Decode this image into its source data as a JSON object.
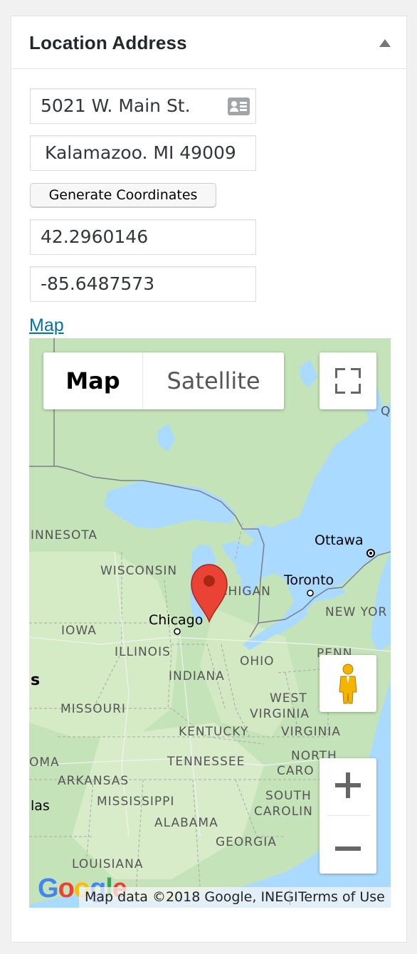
{
  "panel": {
    "title": "Location Address"
  },
  "fields": {
    "street_value": "5021 W. Main St.",
    "city_value": "Kalamazoo. MI 49009",
    "latitude_value": "42.2960146",
    "longitude_value": "-85.6487573"
  },
  "buttons": {
    "generate_label": "Generate Coordinates"
  },
  "map_link": {
    "label": "Map"
  },
  "map": {
    "type_map_label": "Map",
    "type_satellite_label": "Satellite",
    "attribution": "Map data ©2018 Google, INEGI",
    "terms_label": "Terms of Use",
    "logo_letters": [
      "G",
      "o",
      "o",
      "g",
      "l",
      "e"
    ],
    "region_labels": {
      "minnesota": "INNESOTA",
      "wisconsin": "WISCONSIN",
      "michigan": "MICHIGAN",
      "iowa": "IOWA",
      "illinois": "ILLINOIS",
      "indiana": "INDIANA",
      "ohio": "OHIO",
      "penn": "PENN",
      "missouri": "MISSOURI",
      "west_virginia_1": "WEST",
      "west_virginia_2": "VIRGINIA",
      "virginia": "VIRGINIA",
      "kentucky": "KENTUCKY",
      "tennessee": "TENNESSEE",
      "north_carolina_1": "NORTH",
      "north_carolina_2": "CARO",
      "oklahoma": "OMA",
      "arkansas": "ARKANSAS",
      "mississippi": "MISSISSIPPI",
      "alabama": "ALABAMA",
      "georgia": "GEORGIA",
      "south_carolina_1": "SOUTH",
      "south_carolina_2": "CAROLIN",
      "louisiana": "LOUISIANA",
      "new_york": "NEW YOR",
      "edge_s": "s",
      "edge_las": "las",
      "edge_q": "Q"
    },
    "city_labels": {
      "ottawa": "Ottawa",
      "toronto": "Toronto",
      "chicago": "Chicago"
    },
    "colors": {
      "land": "#c5e3b8",
      "water": "#aadaff",
      "pin": "#ea4335",
      "pin_dark": "#a52714",
      "link": "#0073aa"
    }
  }
}
